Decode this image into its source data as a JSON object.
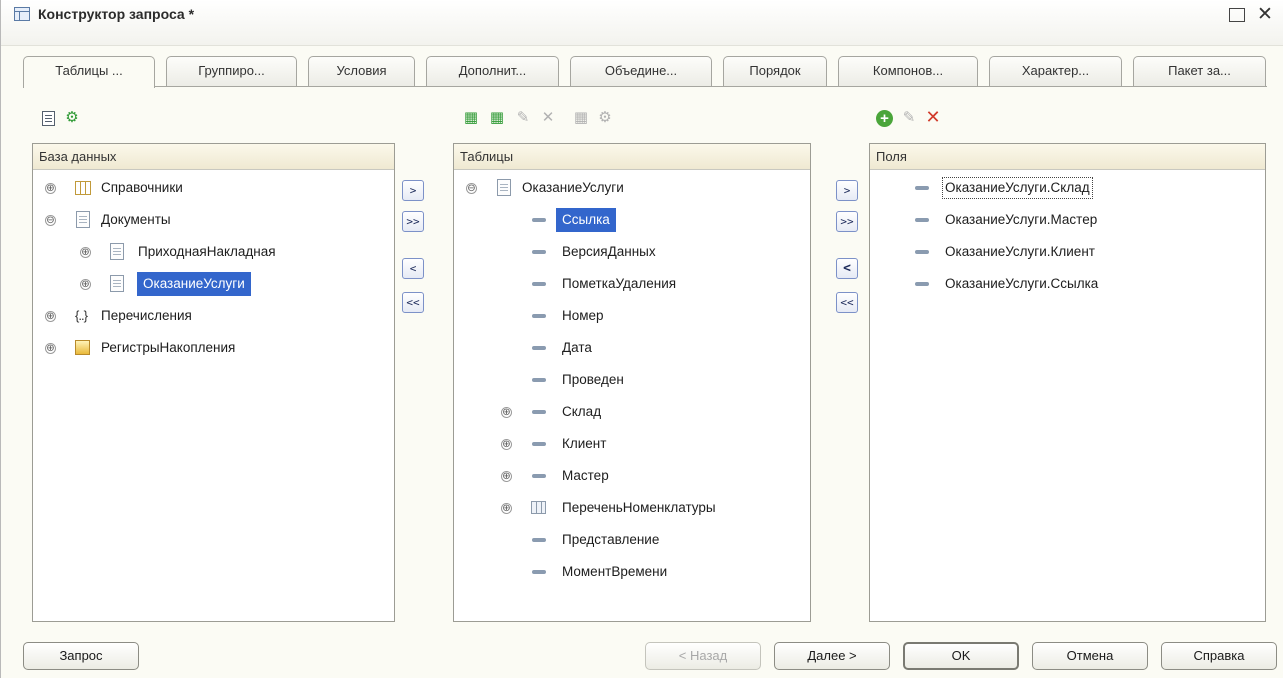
{
  "window": {
    "title": "Конструктор запроса *",
    "maximize_glyph": "",
    "close_glyph": "✕"
  },
  "tabs": [
    {
      "label": "Таблицы ..."
    },
    {
      "label": "Группиро..."
    },
    {
      "label": "Условия"
    },
    {
      "label": "Дополнит..."
    },
    {
      "label": "Объедине..."
    },
    {
      "label": "Порядок"
    },
    {
      "label": "Компонов..."
    },
    {
      "label": "Характер..."
    },
    {
      "label": "Пакет за..."
    }
  ],
  "panels": {
    "database": {
      "header": "База данных",
      "items": [
        {
          "label": "Справочники"
        },
        {
          "label": "Документы"
        },
        {
          "label": "ПриходнаяНакладная"
        },
        {
          "label": "ОказаниеУслуги"
        },
        {
          "label": "Перечисления"
        },
        {
          "label": "РегистрыНакопления"
        }
      ]
    },
    "tables": {
      "header": "Таблицы",
      "items": [
        {
          "label": "ОказаниеУслуги"
        },
        {
          "label": "Ссылка"
        },
        {
          "label": "ВерсияДанных"
        },
        {
          "label": "ПометкаУдаления"
        },
        {
          "label": "Номер"
        },
        {
          "label": "Дата"
        },
        {
          "label": "Проведен"
        },
        {
          "label": "Склад"
        },
        {
          "label": "Клиент"
        },
        {
          "label": "Мастер"
        },
        {
          "label": "ПереченьНоменклатуры"
        },
        {
          "label": "Представление"
        },
        {
          "label": "МоментВремени"
        }
      ]
    },
    "fields": {
      "header": "Поля",
      "items": [
        {
          "label": "ОказаниеУслуги.Склад"
        },
        {
          "label": "ОказаниеУслуги.Мастер"
        },
        {
          "label": "ОказаниеУслуги.Клиент"
        },
        {
          "label": "ОказаниеУслуги.Ссылка"
        }
      ]
    }
  },
  "transfer_buttons": {
    "add_one": ">",
    "add_all": ">>",
    "remove_one": "<",
    "remove_all": "<<"
  },
  "toolbars": {
    "expand_glyph": "⊕",
    "collapse_glyph": "⊖",
    "edit_glyph": "✎",
    "delete_glyph": "✕",
    "add_glyph": "+",
    "add_table_glyph": "▦",
    "settings_glyph": "⚙"
  },
  "buttons": {
    "query": "Запрос",
    "back": "< Назад",
    "next": "Далее >",
    "ok": "OK",
    "cancel": "Отмена",
    "help": "Справка"
  }
}
